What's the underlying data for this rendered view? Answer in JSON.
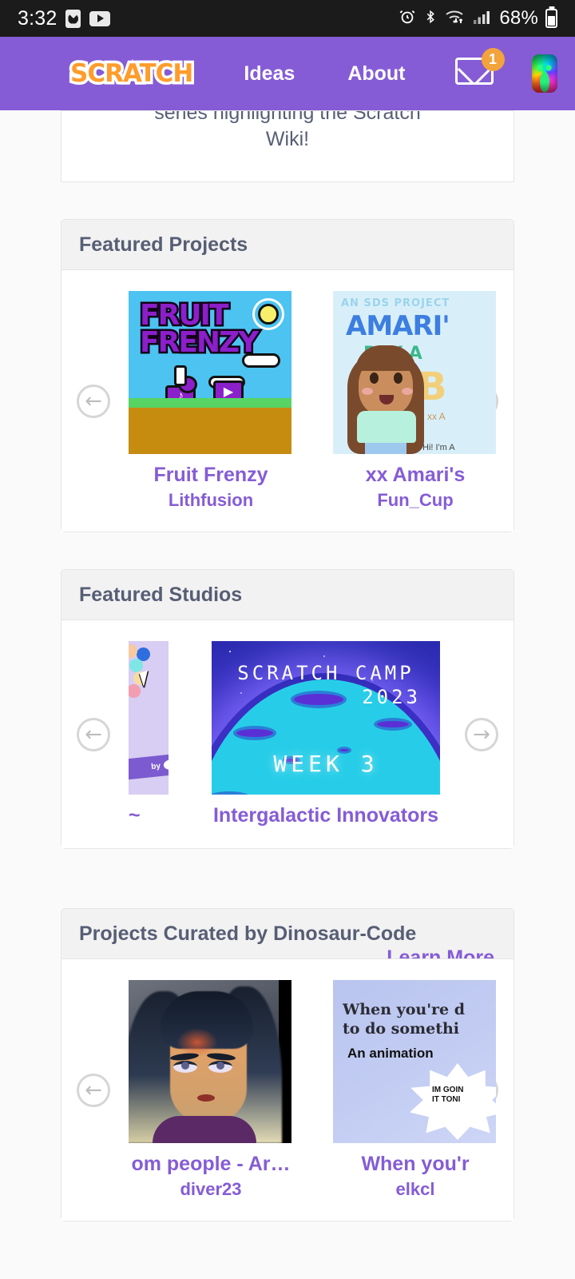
{
  "statusbar": {
    "time": "3:32",
    "battery_percent": "68%",
    "icons": [
      "clock-app-icon",
      "youtube-icon",
      "alarm-icon",
      "bluetooth-icon",
      "wifi-icon",
      "signal-icon",
      "battery-icon"
    ]
  },
  "navbar": {
    "logo_text": "SCRATCH",
    "links": [
      {
        "label": "Ideas",
        "name": "nav-link-ideas"
      },
      {
        "label": "About",
        "name": "nav-link-about"
      }
    ],
    "messages_badge": "1",
    "avatar_label": "user-avatar"
  },
  "teaser_card": {
    "text": "series highlighting the Scratch\nWiki!"
  },
  "sections": [
    {
      "title": "Featured Projects",
      "learn_more": "",
      "prev_label": "←",
      "next_label": "→",
      "items": [
        {
          "name": "Fruit Frenzy",
          "author": "Lithfusion",
          "art": "fruit-frenzy"
        },
        {
          "name": "xx Amari's",
          "author": "Fun_Cup",
          "art": "amari"
        }
      ]
    },
    {
      "title": "Featured Studios",
      "learn_more": "",
      "prev_label": "←",
      "next_label": "→",
      "items": [
        {
          "name": "~",
          "author": "",
          "art": "balloons"
        },
        {
          "name": "Intergalactic Innovators",
          "author": "",
          "art": "scratch-camp"
        }
      ]
    },
    {
      "title": "Projects Curated by Dinosaur-Code",
      "learn_more": "Learn More",
      "prev_label": "←",
      "next_label": "→",
      "items": [
        {
          "name": "om people - Ar…",
          "author": "diver23",
          "art": "portrait"
        },
        {
          "name": "When you'r",
          "author": "elkcl",
          "art": "when-youre"
        }
      ]
    }
  ],
  "thumb_text": {
    "fruit_title_l1": "FRUIT",
    "fruit_title_l2": "FRENZY",
    "amari_sds": "AN SDS PROJECT",
    "amari_title": "AMARI'",
    "amari_day": "DAY A",
    "amari_b": "B",
    "amari_xx": "xx A",
    "amari_hi": "Hi! I'm A",
    "camp_l1": "SCRATCH CAMP",
    "camp_l2": "2023",
    "camp_l3": "WEEK 3",
    "when_l1": "When you're d",
    "when_l2": "to do somethi",
    "when_l3": "An animation",
    "when_burst": "IM GOIN\nIT TONI",
    "balloon_banner": "by"
  },
  "colors": {
    "brand_purple": "#855cd6",
    "link_purple": "#855cd6",
    "heading_slate": "#575e75",
    "badge_orange": "#f2a33c",
    "logo_orange": "#ff9c2b"
  }
}
